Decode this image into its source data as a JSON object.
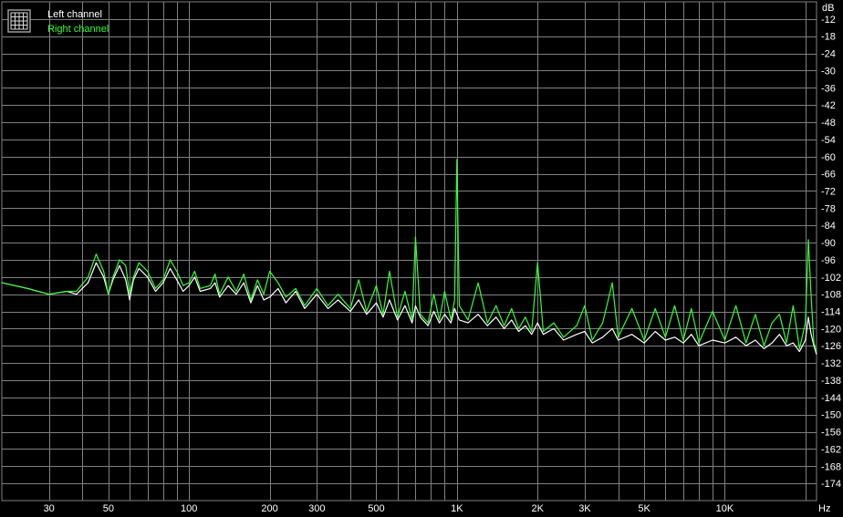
{
  "chart_data": {
    "type": "line",
    "title": "",
    "xlabel": "",
    "ylabel": "",
    "x_unit": "Hz",
    "y_unit": "dB",
    "x_scale": "log",
    "xlim": [
      20,
      22000
    ],
    "ylim": [
      -180,
      -6
    ],
    "grid": true,
    "legend_placement": "top-left",
    "background_color": "#000000",
    "grid_color": "#808080",
    "x_ticks": [
      {
        "value": 30,
        "label": "30"
      },
      {
        "value": 50,
        "label": "50"
      },
      {
        "value": 100,
        "label": "100"
      },
      {
        "value": 200,
        "label": "200"
      },
      {
        "value": 300,
        "label": "300"
      },
      {
        "value": 500,
        "label": "500"
      },
      {
        "value": 1000,
        "label": "1K"
      },
      {
        "value": 2000,
        "label": "2K"
      },
      {
        "value": 3000,
        "label": "3K"
      },
      {
        "value": 5000,
        "label": "5K"
      },
      {
        "value": 10000,
        "label": "10K"
      }
    ],
    "y_ticks": [
      -12,
      -18,
      -24,
      -30,
      -36,
      -42,
      -48,
      -54,
      -60,
      -66,
      -72,
      -78,
      -84,
      -90,
      -96,
      -102,
      -108,
      -114,
      -120,
      -126,
      -132,
      -138,
      -144,
      -150,
      -156,
      -162,
      -168,
      -174
    ],
    "series": [
      {
        "name": "Left channel",
        "color": "#ffffff",
        "x": [
          20,
          25,
          30,
          35,
          38,
          42,
          45,
          48,
          50,
          52,
          55,
          58,
          60,
          62,
          65,
          70,
          75,
          80,
          85,
          90,
          95,
          100,
          105,
          110,
          120,
          125,
          130,
          140,
          150,
          160,
          170,
          180,
          190,
          200,
          215,
          230,
          250,
          270,
          300,
          330,
          360,
          400,
          430,
          460,
          500,
          530,
          560,
          600,
          640,
          680,
          700,
          730,
          780,
          820,
          860,
          900,
          950,
          980,
          1000,
          1020,
          1100,
          1200,
          1300,
          1400,
          1500,
          1600,
          1700,
          1800,
          1900,
          2000,
          2100,
          2300,
          2500,
          2800,
          3000,
          3200,
          3500,
          3800,
          4000,
          4500,
          5000,
          5500,
          6000,
          6500,
          7000,
          7500,
          8000,
          9000,
          10000,
          11000,
          12000,
          13000,
          14000,
          15000,
          16000,
          17000,
          18000,
          19000,
          20000,
          20500,
          21000,
          21500,
          22000
        ],
        "y": [
          -104,
          -106,
          -108,
          -107,
          -108,
          -104,
          -97,
          -102,
          -108,
          -103,
          -98,
          -103,
          -110,
          -103,
          -99,
          -102,
          -107,
          -104,
          -99,
          -103,
          -107,
          -105,
          -102,
          -107,
          -106,
          -104,
          -109,
          -105,
          -108,
          -104,
          -111,
          -105,
          -110,
          -109,
          -106,
          -111,
          -107,
          -113,
          -108,
          -113,
          -110,
          -114,
          -110,
          -115,
          -111,
          -116,
          -110,
          -117,
          -112,
          -118,
          -112,
          -116,
          -119,
          -114,
          -118,
          -115,
          -118,
          -113,
          -115,
          -117,
          -118,
          -115,
          -119,
          -116,
          -120,
          -117,
          -121,
          -119,
          -122,
          -118,
          -122,
          -120,
          -124,
          -122,
          -121,
          -125,
          -123,
          -120,
          -124,
          -122,
          -125,
          -121,
          -124,
          -123,
          -125,
          -122,
          -126,
          -124,
          -125,
          -123,
          -126,
          -124,
          -127,
          -125,
          -122,
          -126,
          -125,
          -128,
          -124,
          -116,
          -122,
          -126,
          -129
        ]
      },
      {
        "name": "Right channel",
        "color": "#33ff33",
        "x": [
          20,
          25,
          30,
          35,
          38,
          42,
          45,
          48,
          50,
          52,
          55,
          58,
          60,
          62,
          65,
          70,
          75,
          80,
          85,
          90,
          95,
          100,
          105,
          110,
          120,
          125,
          130,
          140,
          150,
          160,
          170,
          180,
          190,
          200,
          215,
          230,
          250,
          270,
          300,
          330,
          360,
          400,
          430,
          460,
          500,
          530,
          560,
          600,
          640,
          680,
          700,
          730,
          780,
          820,
          860,
          900,
          950,
          980,
          1000,
          1020,
          1100,
          1200,
          1300,
          1400,
          1500,
          1600,
          1700,
          1800,
          1900,
          2000,
          2100,
          2300,
          2500,
          2800,
          3000,
          3200,
          3500,
          3800,
          4000,
          4500,
          5000,
          5500,
          6000,
          6500,
          7000,
          7500,
          8000,
          9000,
          10000,
          11000,
          12000,
          13000,
          14000,
          15000,
          16000,
          17000,
          18000,
          19000,
          20000,
          20500,
          21000,
          21500,
          22000
        ],
        "y": [
          -104,
          -106,
          -108,
          -107,
          -107,
          -102,
          -94,
          -100,
          -108,
          -102,
          -96,
          -98,
          -108,
          -102,
          -97,
          -100,
          -106,
          -103,
          -96,
          -100,
          -105,
          -104,
          -100,
          -106,
          -105,
          -101,
          -108,
          -102,
          -107,
          -101,
          -110,
          -103,
          -108,
          -100,
          -104,
          -109,
          -106,
          -112,
          -106,
          -112,
          -108,
          -113,
          -103,
          -114,
          -105,
          -115,
          -100,
          -116,
          -107,
          -117,
          -88,
          -115,
          -118,
          -108,
          -117,
          -107,
          -117,
          -110,
          -61,
          -112,
          -117,
          -104,
          -118,
          -112,
          -119,
          -113,
          -120,
          -116,
          -121,
          -97,
          -121,
          -118,
          -123,
          -119,
          -112,
          -124,
          -118,
          -104,
          -123,
          -113,
          -124,
          -113,
          -123,
          -112,
          -124,
          -113,
          -125,
          -114,
          -124,
          -112,
          -125,
          -115,
          -126,
          -118,
          -115,
          -125,
          -112,
          -127,
          -118,
          -89,
          -109,
          -125,
          -128
        ]
      }
    ]
  },
  "legend": {
    "items": [
      {
        "label": "Left channel",
        "color": "#ffffff"
      },
      {
        "label": "Right channel",
        "color": "#33ff33"
      }
    ],
    "icon": "spectrum-grid-icon"
  },
  "axes": {
    "x_unit_label": "Hz",
    "y_unit_label": "dB"
  }
}
